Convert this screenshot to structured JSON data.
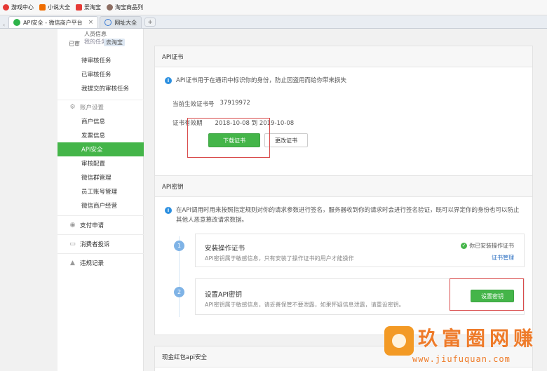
{
  "bookmarks": [
    {
      "label": "游戏中心",
      "color": "#e53935"
    },
    {
      "label": "小说大全",
      "color": "#ef6c00"
    },
    {
      "label": "爱淘宝",
      "color": "#e53935"
    },
    {
      "label": "淘宝商品列",
      "color": "#8d6e63"
    }
  ],
  "tabs": [
    {
      "label": "API安全 - 微信商户平台",
      "close": "×"
    },
    {
      "label": "网址大全"
    }
  ],
  "tab_new": "+",
  "sidebar": {
    "tooltip": {
      "line1": "人员信息",
      "line2": "已审",
      "line3": "我的任务",
      "line4": "去淘宝"
    },
    "group_tasks": [
      "待审核任务",
      "已审核任务",
      "我提交的审核任务"
    ],
    "account_head": "账户设置",
    "account_items": [
      "商户信息",
      "发票信息",
      "API安全",
      "审核配置",
      "微信群管理",
      "员工账号管理",
      "微信商户经营"
    ],
    "pay_apply": "支付申请",
    "complaints": "消费者投诉",
    "violations": "违规记录"
  },
  "cert_panel": {
    "title": "API证书",
    "info": "API证书用于在通讯中标识你的身份，防止因盗用而给你带来损失",
    "serial_label": "当前生效证书号",
    "serial_value": "37919972",
    "validity_label": "证书有效期",
    "validity_value": "2018-10-08  到  2019-10-08",
    "download_btn": "下载证书",
    "change_btn": "更改证书"
  },
  "key_panel": {
    "title": "API密钥",
    "info": "在API调用时用来按照指定规则对你的请求参数进行签名，服务器收到你的请求时会进行签名验证，既可以界定你的身份也可以防止其他人恶意篡改请求数据。",
    "step1": {
      "num": "1",
      "title": "安装操作证书",
      "desc": "API密钥属于敏感信息，只有安装了操作证书的用户才能操作",
      "status": "你已安装操作证书",
      "link": "证书管理"
    },
    "step2": {
      "num": "2",
      "title": "设置API密钥",
      "desc": "API密钥属于敏感信息，请妥善保管不要泄露，如果怀疑信息泄露，请重设密钥。",
      "btn": "设置密钥"
    }
  },
  "bottom_panel": {
    "title": "现金红包api安全"
  },
  "watermark": {
    "title": "玖富圈网赚",
    "url": "www.jiufuquan.com"
  },
  "colors": {
    "accent_green": "#44b549",
    "highlight_red": "#d84a4a",
    "info_blue": "#2b8fe0"
  }
}
